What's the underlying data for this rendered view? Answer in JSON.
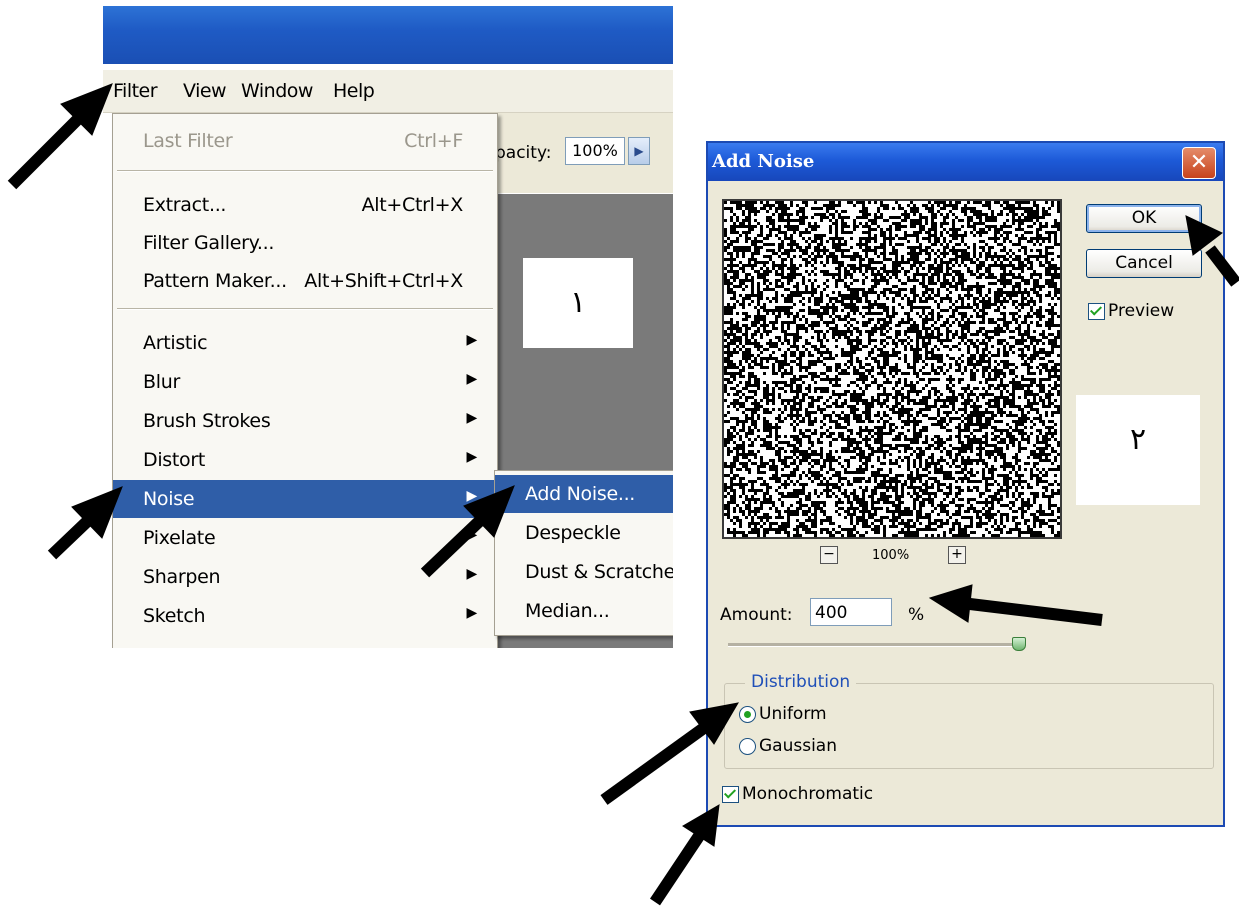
{
  "menubar": {
    "filter": "Filter",
    "view": "View",
    "window": "Window",
    "help": "Help"
  },
  "options_bar": {
    "opacity_label": "pacity:",
    "opacity_value": "100%"
  },
  "canvas_label_1": "١",
  "filter_menu": {
    "last_filter": {
      "label": "Last Filter",
      "shortcut": "Ctrl+F"
    },
    "extract": {
      "label": "Extract...",
      "shortcut": "Alt+Ctrl+X"
    },
    "filter_gallery": {
      "label": "Filter Gallery..."
    },
    "pattern_maker": {
      "label": "Pattern Maker...",
      "shortcut": "Alt+Shift+Ctrl+X"
    },
    "artistic": "Artistic",
    "blur": "Blur",
    "brush_strokes": "Brush Strokes",
    "distort": "Distort",
    "noise": "Noise",
    "pixelate": "Pixelate",
    "sharpen": "Sharpen",
    "sketch": "Sketch"
  },
  "noise_submenu": {
    "add_noise": "Add Noise...",
    "despeckle": "Despeckle",
    "dust_scratches": "Dust & Scratches",
    "median": "Median..."
  },
  "dialog": {
    "title": "Add Noise",
    "close_glyph": "✕",
    "ok_label": "OK",
    "cancel_label": "Cancel",
    "preview_label": "Preview",
    "preview_checked": true,
    "zoom_level": "100%",
    "amount_label": "Amount:",
    "amount_value": "400",
    "amount_unit": "%",
    "amount_slider_fraction": 1.0,
    "distribution_label": "Distribution",
    "uniform_label": "Uniform",
    "gaussian_label": "Gaussian",
    "selected_distribution": "uniform",
    "monochromatic_label": "Monochromatic",
    "monochromatic_checked": true,
    "label_2": "٢"
  },
  "colors": {
    "menu_highlight": "#2f5ea8",
    "title_bar": "#1d5ad8",
    "dialog_bg": "#ece9d8",
    "check_green": "#21a121"
  }
}
